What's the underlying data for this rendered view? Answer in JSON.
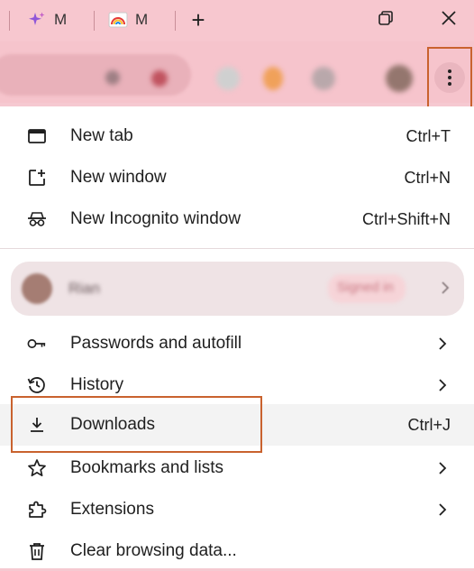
{
  "tabs": [
    {
      "title": "M",
      "icon": "sparkle-icon"
    },
    {
      "title": "M",
      "icon": "rainbow-icon"
    }
  ],
  "window": {
    "new_tab_symbol": "+",
    "restore_symbol": "restore-icon",
    "close_symbol": "close-icon"
  },
  "menu": {
    "top_items": [
      {
        "label": "New tab",
        "shortcut": "Ctrl+T",
        "icon": "new-tab-icon"
      },
      {
        "label": "New window",
        "shortcut": "Ctrl+N",
        "icon": "new-window-icon"
      },
      {
        "label": "New Incognito window",
        "shortcut": "Ctrl+Shift+N",
        "icon": "incognito-icon"
      }
    ],
    "profile": {
      "name": "Rian",
      "status": "Signed in"
    },
    "items": [
      {
        "label": "Passwords and autofill",
        "shortcut": "",
        "icon": "key-icon",
        "submenu": true
      },
      {
        "label": "History",
        "shortcut": "",
        "icon": "history-icon",
        "submenu": true
      },
      {
        "label": "Downloads",
        "shortcut": "Ctrl+J",
        "icon": "download-icon",
        "submenu": false
      },
      {
        "label": "Bookmarks and lists",
        "shortcut": "",
        "icon": "star-icon",
        "submenu": true
      },
      {
        "label": "Extensions",
        "shortcut": "",
        "icon": "puzzle-icon",
        "submenu": true
      },
      {
        "label": "Clear browsing data...",
        "shortcut": "",
        "icon": "trash-icon",
        "submenu": false
      }
    ]
  },
  "colors": {
    "accent_highlight": "#c9622e",
    "frame": "#f7c7cf",
    "menu_bg": "#ffffff"
  }
}
